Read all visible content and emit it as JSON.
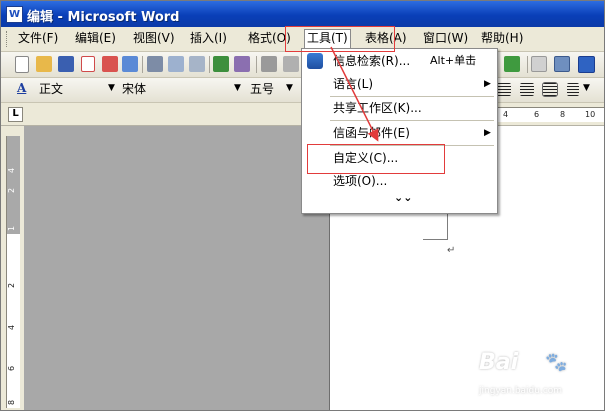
{
  "window": {
    "title": "编辑 - Microsoft Word",
    "app_icon": "word-document-icon"
  },
  "menubar": {
    "items": [
      {
        "label": "文件(F)"
      },
      {
        "label": "编辑(E)"
      },
      {
        "label": "视图(V)"
      },
      {
        "label": "插入(I)"
      },
      {
        "label": "格式(O)"
      },
      {
        "label": "工具(T)"
      },
      {
        "label": "表格(A)"
      },
      {
        "label": "窗口(W)"
      },
      {
        "label": "帮助(H)"
      }
    ]
  },
  "formatting": {
    "style": "正文",
    "font": "宋体",
    "size": "五号"
  },
  "ruler": {
    "tab_selector": "L",
    "h_numbers": [
      "4",
      "6",
      "8",
      "10"
    ],
    "v_numbers": [
      "4",
      "2",
      "1",
      "2",
      "4",
      "6",
      "8"
    ]
  },
  "tools_menu": {
    "items": [
      {
        "label": "信息检索(R)...",
        "shortcut": "Alt+单击",
        "icon": "research-icon"
      },
      {
        "label": "语言(L)",
        "submenu": true
      },
      {
        "label": "共享工作区(K)..."
      },
      {
        "label": "信函与邮件(E)",
        "submenu": true
      },
      {
        "label": "自定义(C)..."
      },
      {
        "label": "选项(O)..."
      }
    ],
    "expand_glyph": "⌄⌄"
  },
  "annotations": {
    "color": "#e23b3b"
  },
  "watermark": {
    "brand": "Bai",
    "paw": "🐾",
    "url": "jingyan.baidu.com"
  }
}
